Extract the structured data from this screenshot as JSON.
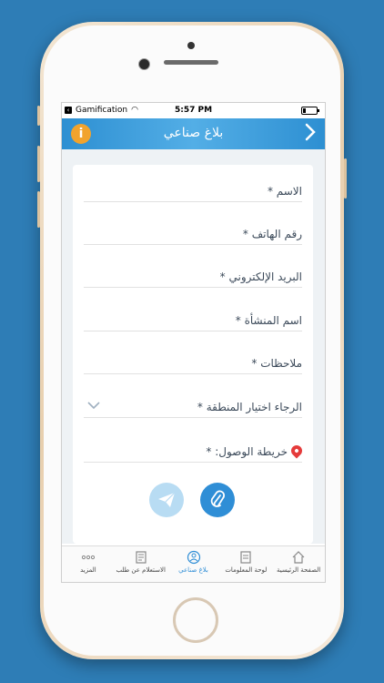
{
  "status_bar": {
    "back_app": "Gamification",
    "time": "5:57 PM",
    "battery_level": 0.2
  },
  "header": {
    "title": "بلاغ صناعي",
    "info_icon": "info-icon",
    "back_icon": "chevron-right-icon"
  },
  "form": {
    "name_label": "الاسم *",
    "phone_label": "رقم الهاتف *",
    "email_label": "البريد الإلكتروني *",
    "facility_label": "اسم المنشأة *",
    "notes_label": "ملاحظات *",
    "region_select": "الرجاء اختيار المنطقة *",
    "map_label": "خريطة الوصول: *",
    "send_icon": "send-icon",
    "attach_icon": "paperclip-icon"
  },
  "tabs": [
    {
      "label": "الصفحة الرئيسية",
      "icon": "home-icon",
      "active": false
    },
    {
      "label": "لوحة المعلومات",
      "icon": "dashboard-icon",
      "active": false
    },
    {
      "label": "بلاغ صناعي",
      "icon": "report-icon",
      "active": true
    },
    {
      "label": "الاستعلام عن طلب",
      "icon": "inquiry-icon",
      "active": false
    },
    {
      "label": "المزيد",
      "icon": "more-icon",
      "active": false
    }
  ],
  "colors": {
    "background": "#2e7db6",
    "accent": "#2f8ed6",
    "info": "#f1a32d",
    "pin": "#e53b3b"
  }
}
